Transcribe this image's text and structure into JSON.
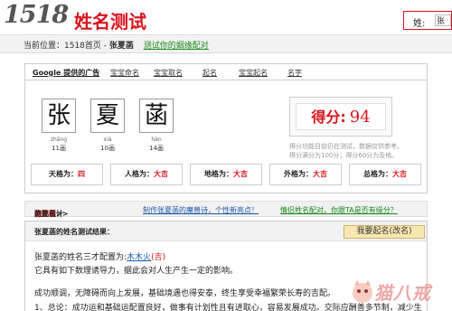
{
  "header": {
    "logo_number": "1518",
    "logo_text": "姓名测试",
    "search_label": "姓:",
    "search_value": "张"
  },
  "breadcrumb": {
    "prefix": "当前位置：1518首页 -",
    "current": "张夏菡",
    "link": "测试你的姻缘配对"
  },
  "tabs": [
    "Google 提供的广告",
    "宝宝命名",
    "宝宝取名",
    "起名",
    "宝宝起名",
    "名字"
  ],
  "name_chars": [
    {
      "char": "张",
      "pinyin": "zhāng",
      "strokes": "11画"
    },
    {
      "char": "夏",
      "pinyin": "xià",
      "strokes": "10画"
    },
    {
      "char": "菡",
      "pinyin": "hàn",
      "strokes": "14画"
    }
  ],
  "score": {
    "label": "得分:",
    "value": "94",
    "note_line1": "得分功能目前仍在测试，数据仅供参考。",
    "note_line2": "得分满分为100分；得分60分为及格。"
  },
  "grid": [
    {
      "label": "天格为：",
      "value": "四"
    },
    {
      "label": "人格为：",
      "value": "大吉"
    },
    {
      "label": "地格为：",
      "value": "大吉"
    },
    {
      "label": "外格为：",
      "value": "大吉"
    },
    {
      "label": "总格为：",
      "value": "大吉"
    }
  ],
  "links": {
    "sign_prefix": "点此设计",
    "sign_name": "张夏菡",
    "sign_suffix": "的签名>>",
    "qq": "制作张夏菡的魔兽诗，个性新亮点！",
    "match": "情侣姓名配对，你跟TA是否有缘分？"
  },
  "result": {
    "title": "张夏菡的姓名测试结果：",
    "rename_button": "我要起名(改名)",
    "sancai_prefix": "张夏菡的姓名三才配置为:",
    "sancai_value": "木木火",
    "sancai_luck": "(吉)",
    "line2": "它具有如下数理诱导力，据此会对人生产生一定的影响。",
    "line3": "成功顺调，无障碍而向上发展，基础境遇也得安泰，终生享受幸福繁荣长寿的吉配。",
    "line4": "1、总论：成功运和基础运配置良好，做事有计划性且有进取心，容易发展成功。交际应酬善多节制，减少生"
  },
  "watermark": {
    "text": "猫八戒"
  }
}
